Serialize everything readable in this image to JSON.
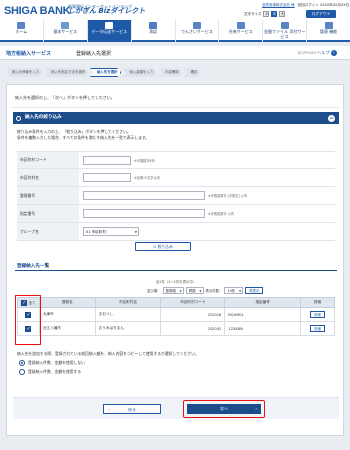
{
  "header": {
    "logo": "SHIGA BANK",
    "brand_line1": "滋賀銀行インターネットバンキング",
    "brand_line2": "しがぎん Bizダイレクト",
    "user_info": "滋賀商事株式会社 様",
    "last_login": "前回ログイン 20XX年XX月XX日",
    "font_size_label": "文字サイズ",
    "sizes": [
      "小",
      "中",
      "大"
    ],
    "logout_label": "ログアウト"
  },
  "nav": [
    {
      "label": "ホーム",
      "icon": "home-icon"
    },
    {
      "label": "基本サービス",
      "icon": "basic-icon"
    },
    {
      "label": "データ伝送サービス",
      "icon": "data-icon"
    },
    {
      "label": "承認",
      "icon": "approve-icon"
    },
    {
      "label": "でんさいサービス",
      "icon": "denshi-icon"
    },
    {
      "label": "外為サービス",
      "icon": "gaitame-icon"
    },
    {
      "label": "金融ファイル 添付サービス",
      "icon": "file-icon"
    },
    {
      "label": "管理 機能",
      "icon": "mgmt-icon"
    }
  ],
  "title": {
    "category": "地方税納入サービス",
    "page": "登録納入先選択",
    "screen_id": "BCZP0604",
    "help": "ヘルプ"
  },
  "steps": [
    "納入元情報を入力",
    "納入先指定方法を選択",
    "納入先を選択",
    "納入金額を入力",
    "内容確認",
    "確定"
  ],
  "instruction": "納入先を選択の上、「次へ」ボタンを押してください。",
  "filter": {
    "title": "納入先の絞り込み",
    "desc1": "絞り込み条件を入力の上、「絞り込み」ボタンを押してください。",
    "desc2": "条件を複数入力した場合、すべての条件を満たす納入先を一覧で表示します。",
    "fields": [
      {
        "label": "市区町村コード",
        "hint": "※半角数字6桁"
      },
      {
        "label": "市区町村名",
        "hint": "※全角15文字以内"
      },
      {
        "label": "整理番号",
        "hint": "※半角英数字 [半角空] 以内"
      },
      {
        "label": "指定番号",
        "hint": "※半角英数字 以内"
      },
      {
        "label": "グループ名",
        "value": "01 市区町村"
      }
    ],
    "button": "絞り込み"
  },
  "list": {
    "title": "登録納入先一覧",
    "pager": "全2件（1〜2件を表示中）",
    "sort_label": "並び順：",
    "sort_value": "登録順",
    "order_value": "昇順",
    "count_label": "表示件数：",
    "count_value": "10件",
    "redisplay": "再表示",
    "headers": [
      "全て",
      "登録名",
      "市区町村名",
      "市区町村コード",
      "指定番号",
      "詳細"
    ],
    "rows": [
      {
        "name": "大津市",
        "city": "おおつし",
        "code": "252018",
        "num": "BQUM01",
        "detail": "詳細"
      },
      {
        "name": "近江八幡市",
        "city": "おうみはちまん",
        "code": "252042",
        "num": "123ABN",
        "detail": "詳細"
      }
    ]
  },
  "bottom": {
    "note": "納入先を追加する際、登録されている前回納入額を、納入内容をコピーして使用するか選択してください。",
    "radio1": "登録納入件数、金額を使用しない",
    "radio2": "登録納入件数、金額を使用する"
  },
  "buttons": {
    "back": "戻る",
    "next": "次へ"
  },
  "colors": {
    "accent": "#1e4d8c",
    "highlight": "#e11111"
  }
}
